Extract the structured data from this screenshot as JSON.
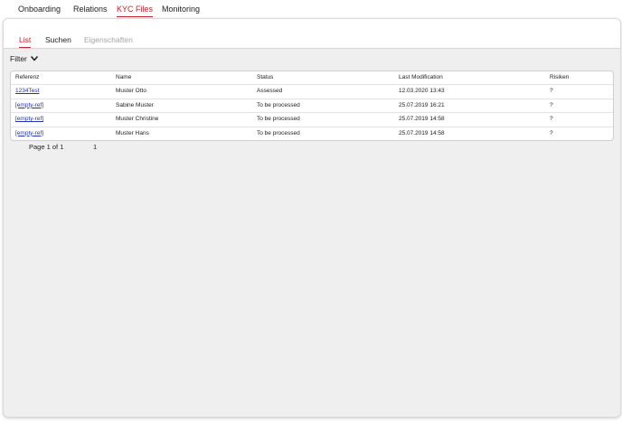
{
  "top_tabs": [
    {
      "label": "Onboarding",
      "active": false
    },
    {
      "label": "Relations",
      "active": false
    },
    {
      "label": "KYC Files",
      "active": true
    },
    {
      "label": "Monitoring",
      "active": false
    }
  ],
  "sub_tabs": [
    {
      "label": "List",
      "active": true
    },
    {
      "label": "Suchen",
      "active": false
    },
    {
      "label": "Eigenschaften",
      "disabled": true
    }
  ],
  "filter": {
    "label": "Filter",
    "icon": "chevron-down-icon"
  },
  "table": {
    "columns": [
      "Referenz",
      "Name",
      "Status",
      "Last Modification",
      "Risiken"
    ],
    "rows": [
      {
        "ref": "1234Test",
        "name": "Muster Otto",
        "status": "Assessed",
        "modified": "12.03.2020 13:43",
        "risk": "?"
      },
      {
        "ref": "[empty-ref]",
        "name": "Sabine Muster",
        "status": "To be processed",
        "modified": "25.07.2019 16:21",
        "risk": "?"
      },
      {
        "ref": "[empty-ref]",
        "name": "Muster Christine",
        "status": "To be processed",
        "modified": "25.07.2019 14:58",
        "risk": "?"
      },
      {
        "ref": "[empty-ref]",
        "name": "Muster Hans",
        "status": "To be processed",
        "modified": "25.07.2019 14:58",
        "risk": "?"
      }
    ]
  },
  "pagination": {
    "page_text": "Page 1 of 1",
    "page_number": "1"
  },
  "colors": {
    "accent": "#c8202e",
    "link": "#2233bb",
    "panel_bg": "#efefef"
  }
}
